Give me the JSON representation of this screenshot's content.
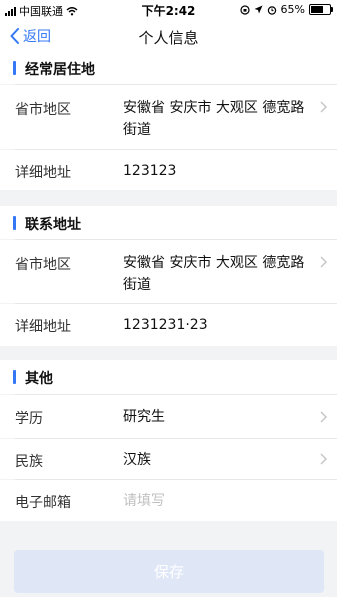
{
  "status_bar": {
    "carrier": "中国联通",
    "time": "下午2:42",
    "battery": "65%",
    "battery_level": 0.65
  },
  "nav": {
    "back_label": "返回",
    "title": "个人信息"
  },
  "sections": {
    "residence": {
      "title": "经常居住地",
      "region_label": "省市地区",
      "region_value": "安徽省 安庆市 大观区 德宽路街道",
      "detail_label": "详细地址",
      "detail_value": "123123"
    },
    "contact": {
      "title": "联系地址",
      "region_label": "省市地区",
      "region_value": "安徽省 安庆市 大观区 德宽路街道",
      "detail_label": "详细地址",
      "detail_value": "1231231·23"
    },
    "other": {
      "title": "其他",
      "education_label": "学历",
      "education_value": "研究生",
      "ethnicity_label": "民族",
      "ethnicity_value": "汉族",
      "email_label": "电子邮箱",
      "email_placeholder": "请填写"
    }
  },
  "save_label": "保存",
  "colors": {
    "accent": "#3478f6",
    "save_button_bg": "#dfe7f7",
    "page_bg": "#f2f3f5"
  }
}
